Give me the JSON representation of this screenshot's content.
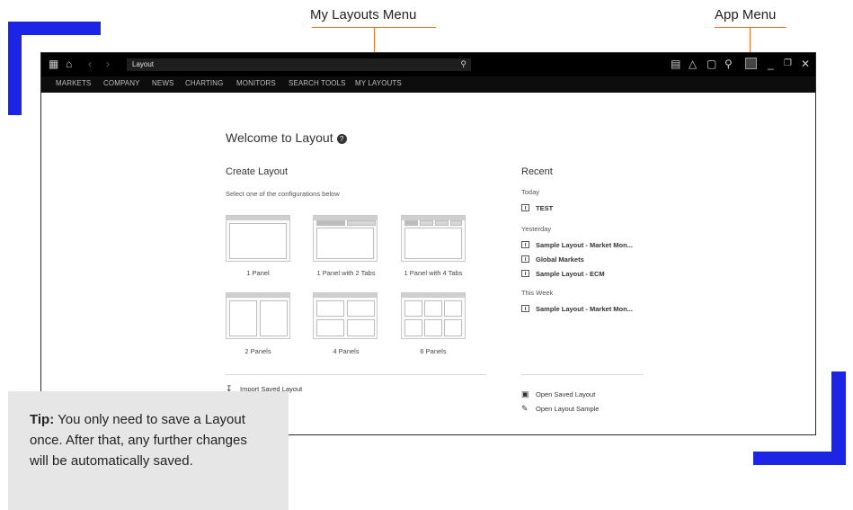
{
  "annotations": {
    "layouts_menu": "My Layouts Menu",
    "app_menu": "App Menu",
    "accent_color": "#f26b21",
    "bar_color": "#1c24e6"
  },
  "titlebar": {
    "search_value": "Layout",
    "icons": [
      "grid-icon",
      "home-icon",
      "back-icon",
      "forward-icon",
      "search-icon",
      "news-icon",
      "bell-icon",
      "chat-icon",
      "user-icon",
      "app-menu-icon",
      "minimize-icon",
      "restore-icon",
      "close-icon"
    ]
  },
  "nav": {
    "markets": "MARKETS",
    "company": "COMPANY",
    "news": "NEWS",
    "charting": "CHARTING",
    "monitors": "MONITORS",
    "search_tools": "SEARCH TOOLS",
    "my_layouts": "MY LAYOUTS"
  },
  "welcome": {
    "title": "Welcome to Layout",
    "help_glyph": "?"
  },
  "create": {
    "heading": "Create Layout",
    "subheading": "Select one of the configurations below",
    "options": [
      "1 Panel",
      "1 Panel with 2 Tabs",
      "1 Panel with 4 Tabs",
      "2 Panels",
      "4 Panels",
      "6 Panels"
    ],
    "import": "Import Saved Layout"
  },
  "recent": {
    "heading": "Recent",
    "today_label": "Today",
    "today": [
      "TEST"
    ],
    "yesterday_label": "Yesterday",
    "yesterday": [
      "Sample Layout - Market Mon...",
      "Global Markets",
      "Sample Layout - ECM"
    ],
    "week_label": "This Week",
    "week": [
      "Sample Layout - Market Mon..."
    ],
    "open_saved": "Open Saved Layout",
    "open_sample": "Open Layout Sample"
  },
  "tip": {
    "label": "Tip:",
    "text": " You only need to save a Layout once. After that, any further changes will be automatically saved."
  }
}
